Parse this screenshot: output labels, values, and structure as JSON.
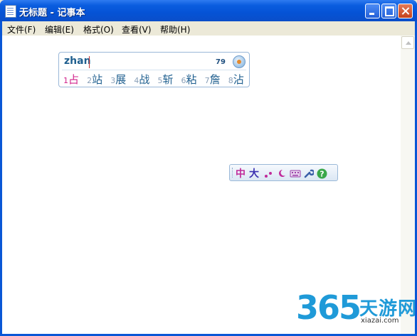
{
  "window": {
    "title": "无标题 - 记事本"
  },
  "menu": [
    "文件(F)",
    "编辑(E)",
    "格式(O)",
    "查看(V)",
    "帮助(H)"
  ],
  "ime": {
    "pinyin": "zhan",
    "count": "79",
    "candidates": [
      {
        "num": "1",
        "char": "占"
      },
      {
        "num": "2",
        "char": "站"
      },
      {
        "num": "3",
        "char": "展"
      },
      {
        "num": "4",
        "char": "战"
      },
      {
        "num": "5",
        "char": "斩"
      },
      {
        "num": "6",
        "char": "粘"
      },
      {
        "num": "7",
        "char": "詹"
      },
      {
        "num": "8",
        "char": "沾"
      }
    ]
  },
  "ime_toolbar": {
    "lang": "中",
    "width": "大",
    "icons": [
      "punctuation-icon",
      "moon-icon",
      "soft-keyboard-icon",
      "wrench-icon",
      "help-icon"
    ]
  },
  "watermark": {
    "number": "365",
    "brand": "天游网",
    "url": "xiazai.com"
  },
  "colors": {
    "titlebar": "#0553d6",
    "ime_accent": "#d0208a",
    "watermark": "#1f9ad8"
  }
}
